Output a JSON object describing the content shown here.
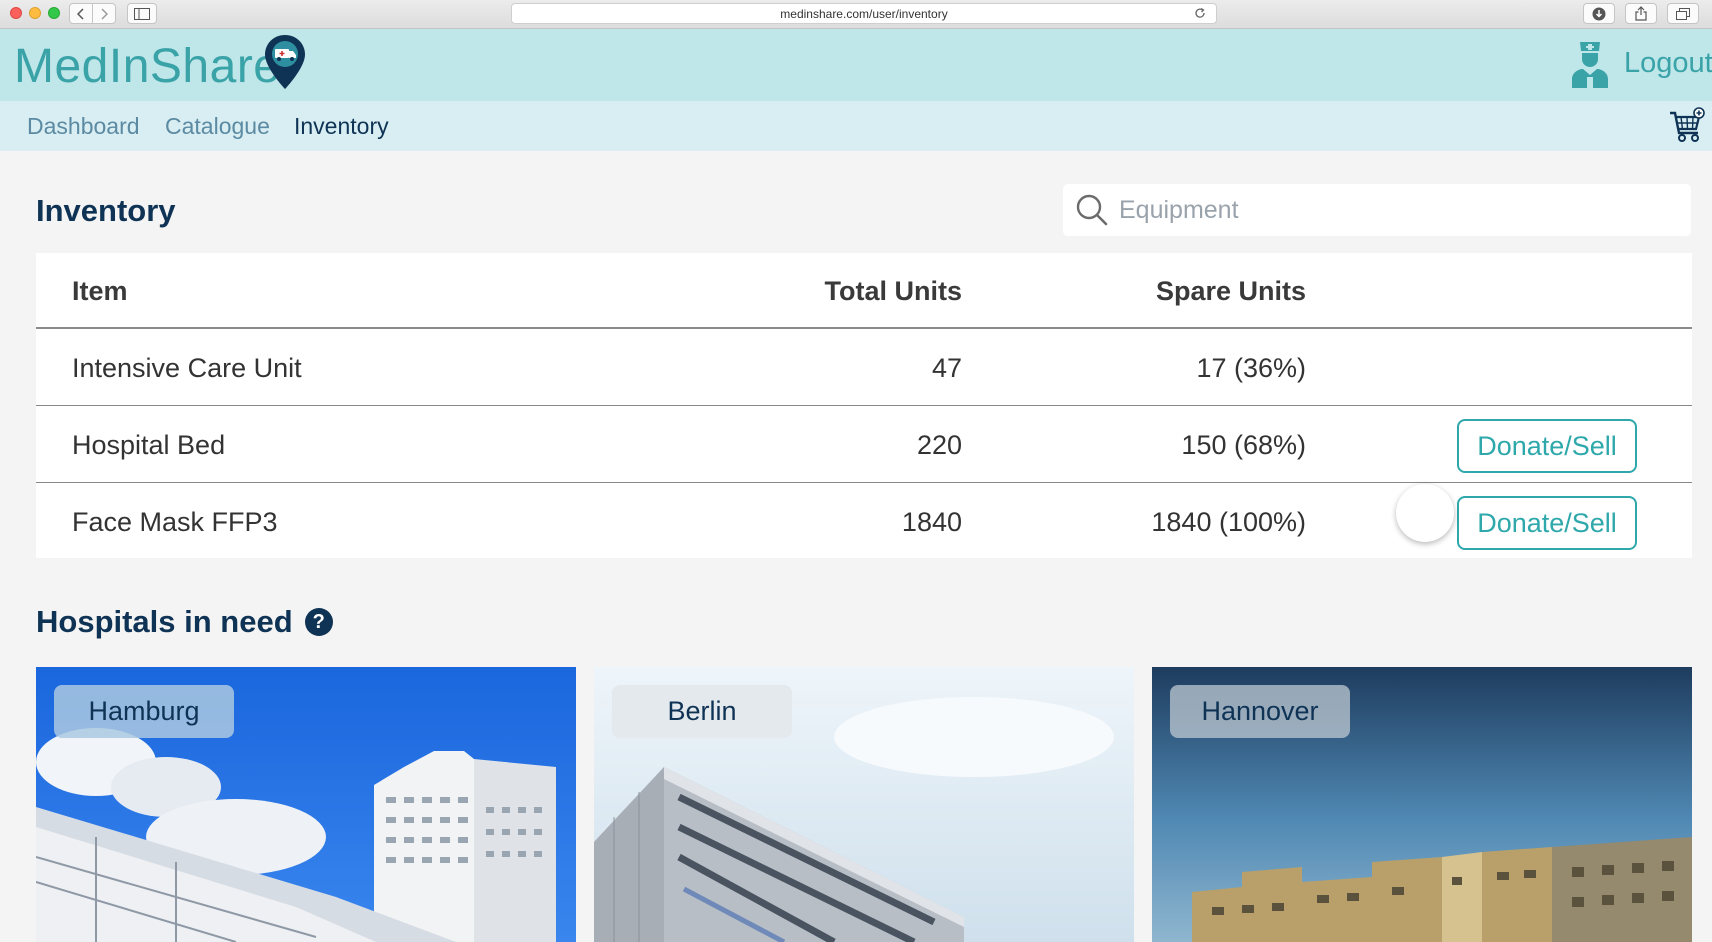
{
  "browser": {
    "url": "medinshare.com/user/inventory"
  },
  "header": {
    "brand": "MedInShare",
    "logout_label": "Logout"
  },
  "nav": {
    "items": [
      {
        "label": "Dashboard"
      },
      {
        "label": "Catalogue"
      },
      {
        "label": "Inventory",
        "active": true
      }
    ]
  },
  "inventory": {
    "title": "Inventory",
    "search_placeholder": "Equipment",
    "columns": {
      "item": "Item",
      "total": "Total Units",
      "spare": "Spare Units"
    },
    "rows": [
      {
        "item": "Intensive Care Unit",
        "total": "47",
        "spare": "17 (36%)"
      },
      {
        "item": "Hospital Bed",
        "total": "220",
        "spare": "150 (68%)",
        "action": "Donate/Sell"
      },
      {
        "item": "Face Mask FFP3",
        "total": "1840",
        "spare": "1840 (100%)",
        "action": "Donate/Sell"
      }
    ]
  },
  "hospitals": {
    "title": "Hospitals in need",
    "help_symbol": "?",
    "cards": [
      {
        "city": "Hamburg"
      },
      {
        "city": "Berlin"
      },
      {
        "city": "Hannover"
      }
    ]
  },
  "colors": {
    "teal": "#3aa3a8",
    "navy": "#0f3355",
    "header_bg": "#bfe6e9",
    "nav_bg": "#d8eef2"
  }
}
